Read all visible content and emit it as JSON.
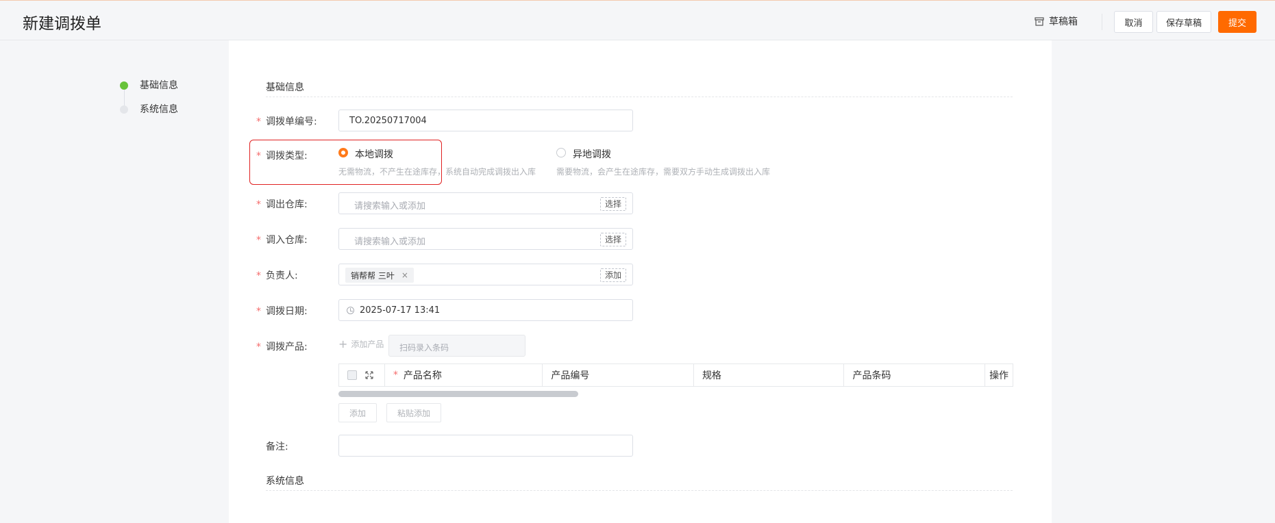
{
  "header": {
    "title": "新建调拨单",
    "draft_box": "草稿箱",
    "cancel": "取消",
    "save_draft": "保存草稿",
    "submit": "提交"
  },
  "steps": [
    {
      "label": "基础信息",
      "active": true
    },
    {
      "label": "系统信息",
      "active": false
    }
  ],
  "colors": {
    "accent": "#ff6a00",
    "step_active": "#67c23a",
    "step_inactive": "#e4e6ea",
    "required": "#f56c6c"
  },
  "form": {
    "section_basic": "基础信息",
    "section_system": "系统信息",
    "required_mark": "*",
    "order_no": {
      "label": "调拨单编号:",
      "value": "TO.20250717004"
    },
    "type": {
      "label": "调拨类型:",
      "options": [
        {
          "label": "本地调拨",
          "desc": "无需物流，不产生在途库存，系统自动完成调拨出入库",
          "selected": true
        },
        {
          "label": "异地调拨",
          "desc": "需要物流，会产生在途库存，需要双方手动生成调拨出入库",
          "selected": false
        }
      ]
    },
    "out_wh": {
      "label": "调出仓库:",
      "placeholder": "请搜索输入或添加",
      "button": "选择"
    },
    "in_wh": {
      "label": "调入仓库:",
      "placeholder": "请搜索输入或添加",
      "button": "选择"
    },
    "owner": {
      "label": "负责人:",
      "tag": "销帮帮 三叶",
      "tag_close": "×",
      "button": "添加"
    },
    "date": {
      "label": "调拨日期:",
      "value": "2025-07-17 13:41"
    },
    "products": {
      "label": "调拨产品:",
      "add": "添加产品",
      "scan_placeholder": "扫码录入条码",
      "columns": [
        "产品名称",
        "产品编号",
        "规格",
        "产品条码",
        "操作"
      ],
      "add_button": "添加",
      "paste_button": "粘贴添加"
    },
    "remark": {
      "label": "备注:",
      "value": ""
    }
  }
}
